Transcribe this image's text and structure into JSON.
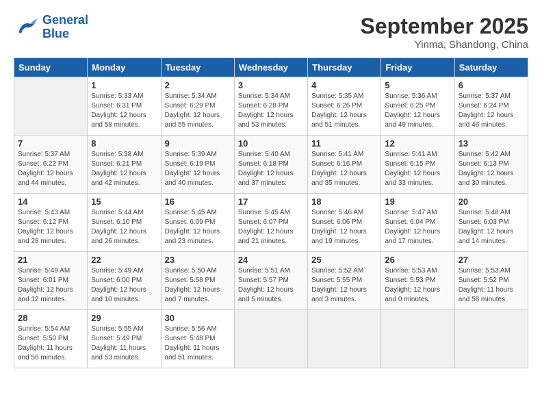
{
  "header": {
    "logo_line1": "General",
    "logo_line2": "Blue",
    "month": "September 2025",
    "location": "Yinma, Shandong, China"
  },
  "days_of_week": [
    "Sunday",
    "Monday",
    "Tuesday",
    "Wednesday",
    "Thursday",
    "Friday",
    "Saturday"
  ],
  "weeks": [
    [
      {
        "day": "",
        "info": ""
      },
      {
        "day": "1",
        "info": "Sunrise: 5:33 AM\nSunset: 6:31 PM\nDaylight: 12 hours\nand 58 minutes."
      },
      {
        "day": "2",
        "info": "Sunrise: 5:34 AM\nSunset: 6:29 PM\nDaylight: 12 hours\nand 55 minutes."
      },
      {
        "day": "3",
        "info": "Sunrise: 5:34 AM\nSunset: 6:28 PM\nDaylight: 12 hours\nand 53 minutes."
      },
      {
        "day": "4",
        "info": "Sunrise: 5:35 AM\nSunset: 6:26 PM\nDaylight: 12 hours\nand 51 minutes."
      },
      {
        "day": "5",
        "info": "Sunrise: 5:36 AM\nSunset: 6:25 PM\nDaylight: 12 hours\nand 49 minutes."
      },
      {
        "day": "6",
        "info": "Sunrise: 5:37 AM\nSunset: 6:24 PM\nDaylight: 12 hours\nand 46 minutes."
      }
    ],
    [
      {
        "day": "7",
        "info": "Sunrise: 5:37 AM\nSunset: 6:22 PM\nDaylight: 12 hours\nand 44 minutes."
      },
      {
        "day": "8",
        "info": "Sunrise: 5:38 AM\nSunset: 6:21 PM\nDaylight: 12 hours\nand 42 minutes."
      },
      {
        "day": "9",
        "info": "Sunrise: 5:39 AM\nSunset: 6:19 PM\nDaylight: 12 hours\nand 40 minutes."
      },
      {
        "day": "10",
        "info": "Sunrise: 5:40 AM\nSunset: 6:18 PM\nDaylight: 12 hours\nand 37 minutes."
      },
      {
        "day": "11",
        "info": "Sunrise: 5:41 AM\nSunset: 6:16 PM\nDaylight: 12 hours\nand 35 minutes."
      },
      {
        "day": "12",
        "info": "Sunrise: 5:41 AM\nSunset: 6:15 PM\nDaylight: 12 hours\nand 33 minutes."
      },
      {
        "day": "13",
        "info": "Sunrise: 5:42 AM\nSunset: 6:13 PM\nDaylight: 12 hours\nand 30 minutes."
      }
    ],
    [
      {
        "day": "14",
        "info": "Sunrise: 5:43 AM\nSunset: 6:12 PM\nDaylight: 12 hours\nand 28 minutes."
      },
      {
        "day": "15",
        "info": "Sunrise: 5:44 AM\nSunset: 6:10 PM\nDaylight: 12 hours\nand 26 minutes."
      },
      {
        "day": "16",
        "info": "Sunrise: 5:45 AM\nSunset: 6:09 PM\nDaylight: 12 hours\nand 23 minutes."
      },
      {
        "day": "17",
        "info": "Sunrise: 5:45 AM\nSunset: 6:07 PM\nDaylight: 12 hours\nand 21 minutes."
      },
      {
        "day": "18",
        "info": "Sunrise: 5:46 AM\nSunset: 6:06 PM\nDaylight: 12 hours\nand 19 minutes."
      },
      {
        "day": "19",
        "info": "Sunrise: 5:47 AM\nSunset: 6:04 PM\nDaylight: 12 hours\nand 17 minutes."
      },
      {
        "day": "20",
        "info": "Sunrise: 5:48 AM\nSunset: 6:03 PM\nDaylight: 12 hours\nand 14 minutes."
      }
    ],
    [
      {
        "day": "21",
        "info": "Sunrise: 5:49 AM\nSunset: 6:01 PM\nDaylight: 12 hours\nand 12 minutes."
      },
      {
        "day": "22",
        "info": "Sunrise: 5:49 AM\nSunset: 6:00 PM\nDaylight: 12 hours\nand 10 minutes."
      },
      {
        "day": "23",
        "info": "Sunrise: 5:50 AM\nSunset: 5:58 PM\nDaylight: 12 hours\nand 7 minutes."
      },
      {
        "day": "24",
        "info": "Sunrise: 5:51 AM\nSunset: 5:57 PM\nDaylight: 12 hours\nand 5 minutes."
      },
      {
        "day": "25",
        "info": "Sunrise: 5:52 AM\nSunset: 5:55 PM\nDaylight: 12 hours\nand 3 minutes."
      },
      {
        "day": "26",
        "info": "Sunrise: 5:53 AM\nSunset: 5:53 PM\nDaylight: 12 hours\nand 0 minutes."
      },
      {
        "day": "27",
        "info": "Sunrise: 5:53 AM\nSunset: 5:52 PM\nDaylight: 11 hours\nand 58 minutes."
      }
    ],
    [
      {
        "day": "28",
        "info": "Sunrise: 5:54 AM\nSunset: 5:50 PM\nDaylight: 11 hours\nand 56 minutes."
      },
      {
        "day": "29",
        "info": "Sunrise: 5:55 AM\nSunset: 5:49 PM\nDaylight: 11 hours\nand 53 minutes."
      },
      {
        "day": "30",
        "info": "Sunrise: 5:56 AM\nSunset: 5:48 PM\nDaylight: 11 hours\nand 51 minutes."
      },
      {
        "day": "",
        "info": ""
      },
      {
        "day": "",
        "info": ""
      },
      {
        "day": "",
        "info": ""
      },
      {
        "day": "",
        "info": ""
      }
    ]
  ]
}
